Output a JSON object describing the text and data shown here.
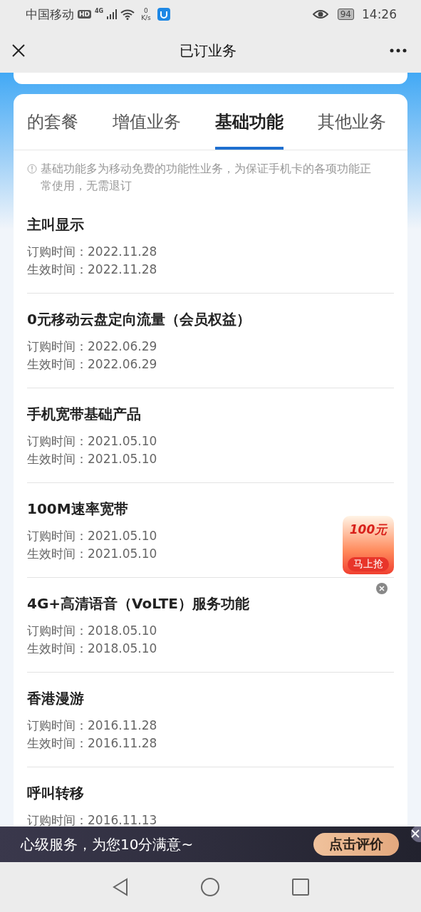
{
  "status_bar": {
    "carrier": "中国移动",
    "hd": "HD",
    "network": "4G",
    "speed_value": "0",
    "speed_unit": "K/s",
    "battery": "94",
    "time": "14:26"
  },
  "header": {
    "title": "已订业务"
  },
  "tabs": [
    {
      "label": "的套餐",
      "selected": false
    },
    {
      "label": "增值业务",
      "selected": false
    },
    {
      "label": "基础功能",
      "selected": true
    },
    {
      "label": "其他业务",
      "selected": false
    }
  ],
  "notice": "基础功能多为移动免费的功能性业务，为保证手机卡的各项功能正常使用，无需退订",
  "services": [
    {
      "name": "主叫显示",
      "dates": [
        {
          "label": "订购时间：",
          "value": "2022.11.28"
        },
        {
          "label": "生效时间：",
          "value": "2022.11.28"
        }
      ]
    },
    {
      "name": "0元移动云盘定向流量（会员权益）",
      "dates": [
        {
          "label": "订购时间：",
          "value": "2022.06.29"
        },
        {
          "label": "生效时间：",
          "value": "2022.06.29"
        }
      ]
    },
    {
      "name": "手机宽带基础产品",
      "dates": [
        {
          "label": "订购时间：",
          "value": "2021.05.10"
        },
        {
          "label": "生效时间：",
          "value": "2021.05.10"
        }
      ]
    },
    {
      "name": "100M速率宽带",
      "dates": [
        {
          "label": "订购时间：",
          "value": "2021.05.10"
        },
        {
          "label": "生效时间：",
          "value": "2021.05.10"
        }
      ]
    },
    {
      "name": "4G+高清语音（VoLTE）服务功能",
      "dates": [
        {
          "label": "订购时间：",
          "value": "2018.05.10"
        },
        {
          "label": "生效时间：",
          "value": "2018.05.10"
        }
      ]
    },
    {
      "name": "香港漫游",
      "dates": [
        {
          "label": "订购时间：",
          "value": "2016.11.28"
        },
        {
          "label": "生效时间：",
          "value": "2016.11.28"
        }
      ]
    },
    {
      "name": "呼叫转移",
      "dates": [
        {
          "label": "订购时间：",
          "value": "2016.11.13"
        }
      ]
    }
  ],
  "promo": {
    "amount": "100元",
    "action": "马上抢"
  },
  "banner": {
    "text": "心级服务，为您10分满意~",
    "button": "点击评价"
  }
}
